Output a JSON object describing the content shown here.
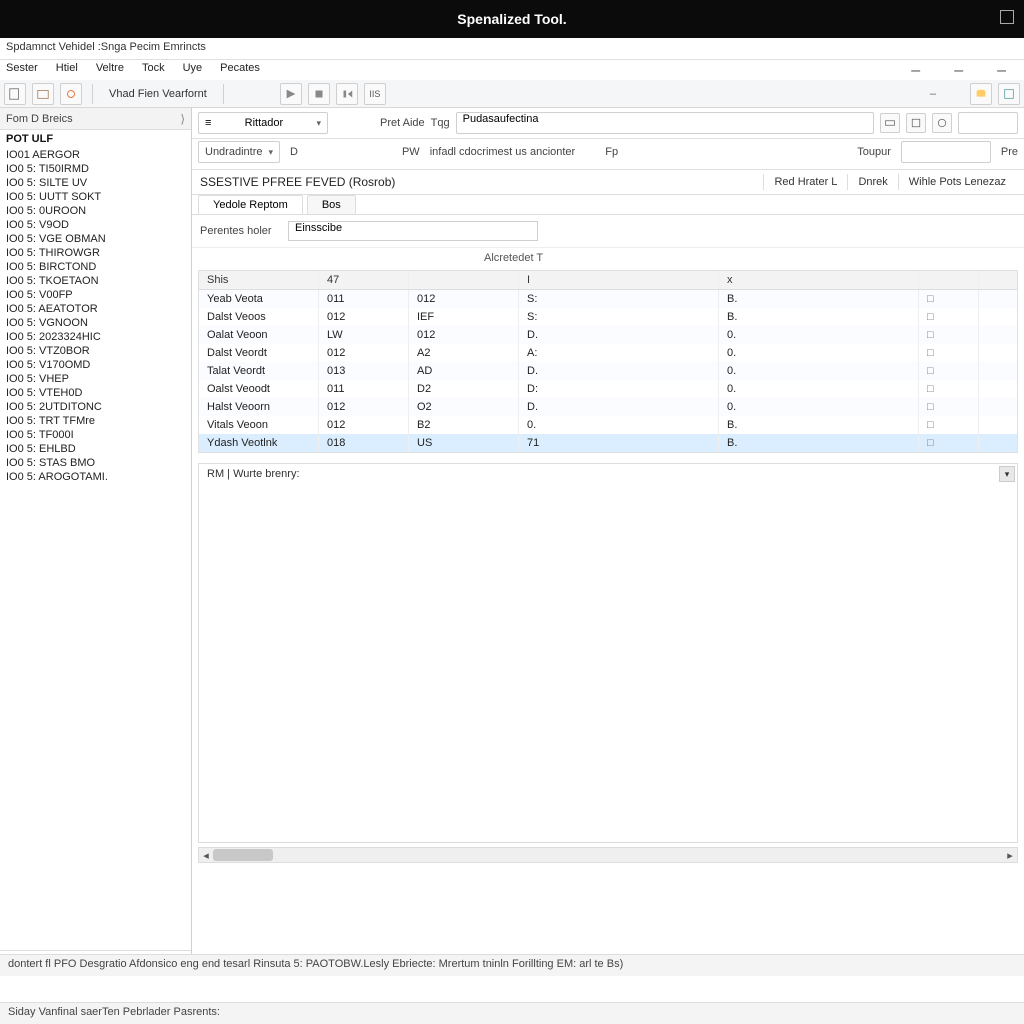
{
  "titlebar": {
    "title": "Spenalized Tool."
  },
  "subheader": "Spdamnct Vehidel :Snga Pecim Emrincts",
  "menu": [
    "Sester",
    "Htiel",
    "Veltre",
    "Tock",
    "Uye",
    "Pecates"
  ],
  "toolbar": {
    "label": "Vhad Fien Vearfornt"
  },
  "sidebar": {
    "header": "Fom D Breics",
    "first": "POT ULF",
    "items": [
      "IO01 AERGOR",
      "IO0 5: TI50IRMD",
      "IO0 5: SILTE UV",
      "IO0 5: UUTT SOKT",
      "IO0 5: 0UROON",
      "IO0 5: V9OD",
      "IO0 5: VGE OBMAN",
      "IO0 5: THIROWGR",
      "IO0 5: BIRCTOND",
      "IO0 5: TKOETAON",
      "IO0 5: V00FP",
      "IO0 5: AEATOTOR",
      "IO0 5: VGNOON",
      "IO0 5: 2023324HIC",
      "IO0 5: VTZ0BOR",
      "IO0 5: V170OMD",
      "IO0 5: VHEP",
      "IO0 5: VTEH0D",
      "IO0 5: 2UTDITONC",
      "IO0 5: TRT TFMre",
      "IO0 5: TF000I",
      "IO0 5: EHLBD",
      "IO0 5: STAS BMO",
      "IO0 5: AROGOTAMI."
    ]
  },
  "filter": {
    "dd1": "Rittador",
    "dd2_lbl": "Undradintre",
    "dd2_val": "D",
    "lbl_preaide": "Pret Aide",
    "lbl_tag": "Tqg",
    "input_tag": "Pudasaufectina",
    "lbl_pw": "PW",
    "lbl_infd": "infadl cdocrimest us ancionter",
    "lbl_tp": "Fp",
    "lbl_toupour": "Toupur",
    "lbl_pre": "Pre"
  },
  "sheet": {
    "title": "SSESTIVE PFREE FEVED (Rosrob)",
    "btns": [
      "Red Hrater L",
      "Dnrek",
      "Wihle Pots Lenezaz"
    ],
    "tabs": [
      "Yedole Reptom",
      "Bos"
    ],
    "field_lbl": "Perentes holer",
    "field_val": "Einsscibe",
    "subcap": "Alcretedet T",
    "cols": [
      "Shis",
      "47",
      "",
      "I",
      "x",
      ""
    ],
    "rows": [
      [
        "Yeab Veota",
        "011",
        "012",
        "S:",
        "B.",
        "□"
      ],
      [
        "Dalst Veoos",
        "012",
        "IEF",
        "S:",
        "B.",
        "□"
      ],
      [
        "Oalat Veoon",
        "LW",
        "012",
        "D.",
        "0.",
        "□"
      ],
      [
        "Dalst Veordt",
        "012",
        "A2",
        "A:",
        "0.",
        "□"
      ],
      [
        "Talat Veordt",
        "013",
        "AD",
        "D.",
        "0.",
        "□"
      ],
      [
        "Oalst Veoodt",
        "011",
        "D2",
        "D:",
        "0.",
        "□"
      ],
      [
        "Halst Veoorn",
        "012",
        "O2",
        "D.",
        "0.",
        "□"
      ],
      [
        "Vitals Veoon",
        "012",
        "B2",
        "0.",
        "B.",
        "□"
      ],
      [
        "Ydash Veotlnk",
        "018",
        "US",
        "71",
        "B.",
        "□"
      ]
    ],
    "selected_row": 8
  },
  "notes": {
    "label": "RM | Wurte brenry:"
  },
  "status": "dontert fl PFO Desgratio Afdonsico eng end tesarl Rinsuta 5: PAOTOBW.Lesly Ebriecte: Mrertum tninln Forillting EM: arl te Bs)",
  "bottom": "Siday Vanfinal saerTen Pebrlader Pasrents:"
}
